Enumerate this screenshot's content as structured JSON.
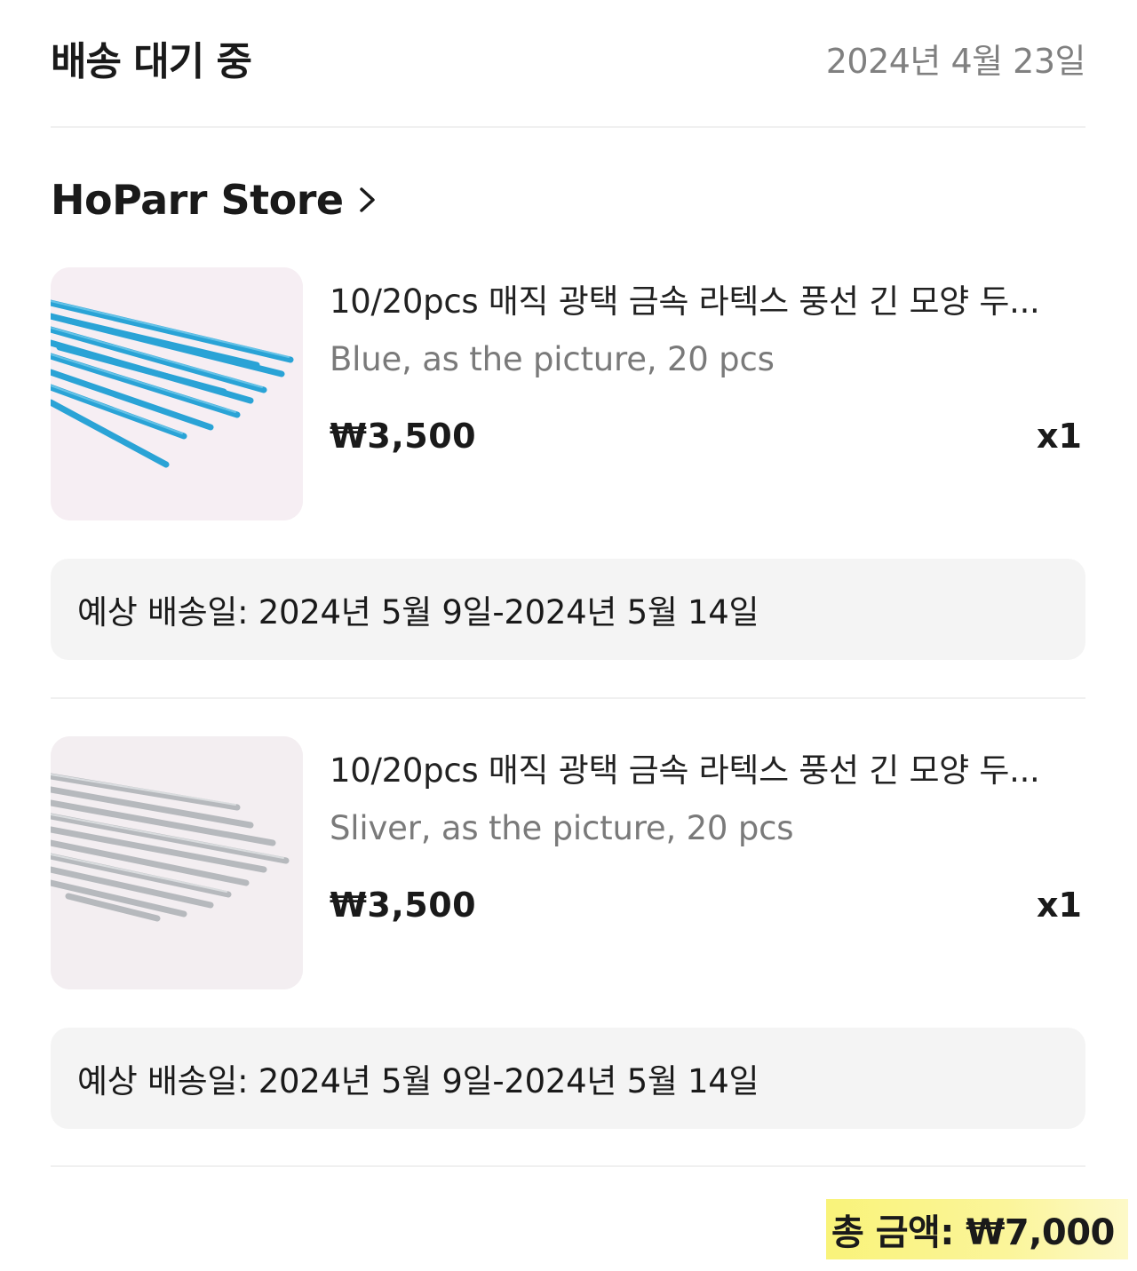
{
  "header": {
    "status": "배송 대기 중",
    "date": "2024년 4월 23일"
  },
  "store": {
    "name": "HoParr Store"
  },
  "items": [
    {
      "title": "10/20pcs 매직 광택 금속 라텍스 풍선 긴 모양 두...",
      "variant": "Blue, as the picture, 20 pcs",
      "price": "₩3,500",
      "qty": "x1",
      "image_color": "#2aa3d6",
      "delivery": "예상 배송일: 2024년 5월 9일-2024년 5월 14일"
    },
    {
      "title": "10/20pcs 매직 광택 금속 라텍스 풍선 긴 모양 두...",
      "variant": "Sliver, as the picture, 20 pcs",
      "price": "₩3,500",
      "qty": "x1",
      "image_color": "#b9bcc0",
      "delivery": "예상 배송일: 2024년 5월 9일-2024년 5월 14일"
    }
  ],
  "total": {
    "label": "총 금액: ₩7,000",
    "highlight_color": "#f9f37a"
  }
}
